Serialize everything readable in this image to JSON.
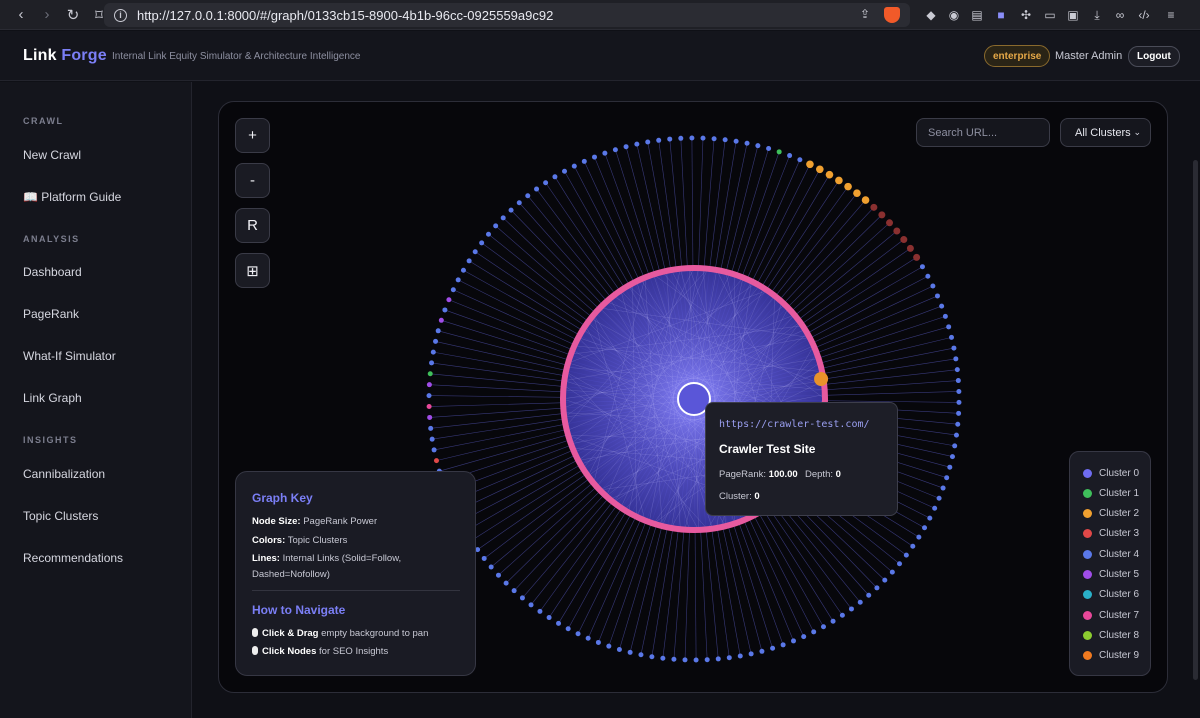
{
  "browser": {
    "url": "http://127.0.0.1:8000/#/graph/0133cb15-8900-4b1b-96cc-0925559a9c92"
  },
  "header": {
    "logo_part1": "Link",
    "logo_part2": "Forge",
    "tagline": "Internal Link Equity Simulator & Architecture Intelligence",
    "plan_badge": "enterprise",
    "user_name": "Master Admin",
    "logout_label": "Logout"
  },
  "sidebar": {
    "sections": [
      {
        "title": "CRAWL",
        "items": [
          "New Crawl",
          "📖 Platform Guide"
        ]
      },
      {
        "title": "ANALYSIS",
        "items": [
          "Dashboard",
          "PageRank",
          "What-If Simulator",
          "Link Graph"
        ]
      },
      {
        "title": "INSIGHTS",
        "items": [
          "Cannibalization",
          "Topic Clusters",
          "Recommendations"
        ]
      }
    ]
  },
  "controls": {
    "zoom_in": "+",
    "zoom_out": "-",
    "reset": "R",
    "fit": "⊞"
  },
  "search": {
    "placeholder": "Search URL..."
  },
  "cluster_filter": {
    "selected": "All Clusters"
  },
  "graph_key": {
    "title": "Graph Key",
    "node_size_label": "Node Size:",
    "node_size_value": "PageRank Power",
    "colors_label": "Colors:",
    "colors_value": "Topic Clusters",
    "lines_label": "Lines:",
    "lines_value": "Internal Links (Solid=Follow, Dashed=Nofollow)",
    "nav_title": "How to Navigate",
    "nav_1_bold": "Click & Drag",
    "nav_1_text": "empty background to pan",
    "nav_2_bold": "Click Nodes",
    "nav_2_text": "for SEO Insights"
  },
  "tooltip": {
    "url": "https://crawler-test.com/",
    "title": "Crawler Test Site",
    "pagerank_label": "PageRank:",
    "pagerank_value": "100.00",
    "depth_label": "Depth:",
    "depth_value": "0",
    "cluster_label": "Cluster:",
    "cluster_value": "0"
  },
  "legend": {
    "clusters": [
      {
        "label": "Cluster 0",
        "color": "#6f6cf0"
      },
      {
        "label": "Cluster 1",
        "color": "#3fbf5b"
      },
      {
        "label": "Cluster 2",
        "color": "#f0a030"
      },
      {
        "label": "Cluster 3",
        "color": "#e04848"
      },
      {
        "label": "Cluster 4",
        "color": "#5a78e8"
      },
      {
        "label": "Cluster 5",
        "color": "#a04de8"
      },
      {
        "label": "Cluster 6",
        "color": "#2ab0c8"
      },
      {
        "label": "Cluster 7",
        "color": "#e8489a"
      },
      {
        "label": "Cluster 8",
        "color": "#8ccc30"
      },
      {
        "label": "Cluster 9",
        "color": "#f07a20"
      }
    ]
  },
  "colors": {
    "accent": "#7b7ff6",
    "hub_ring": "#e75a9f",
    "edge": "#6a6ce8"
  }
}
